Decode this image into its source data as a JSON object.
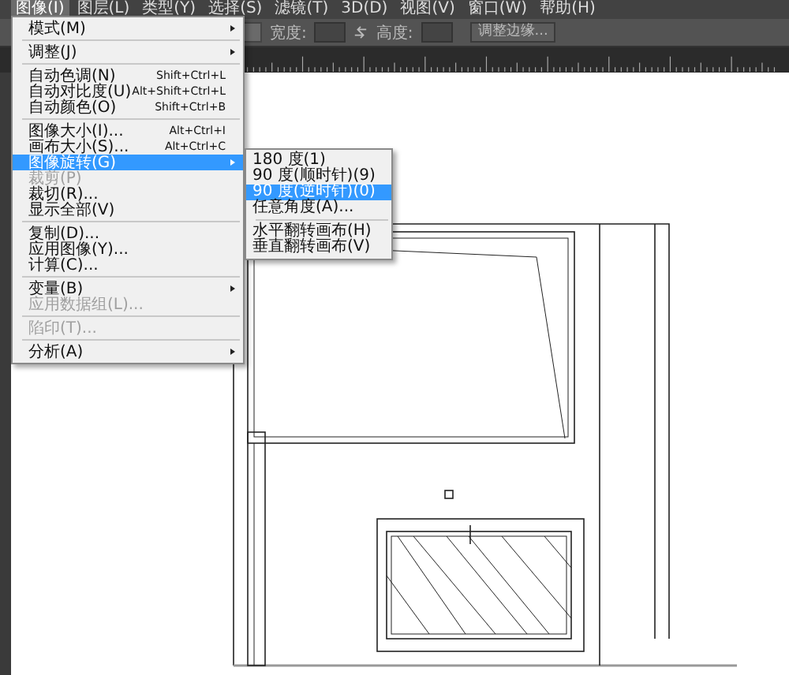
{
  "menubar": {
    "items": [
      {
        "label": "图像(I)",
        "selected": true
      },
      {
        "label": "图层(L)",
        "selected": false
      },
      {
        "label": "类型(Y)",
        "selected": false
      },
      {
        "label": "选择(S)",
        "selected": false
      },
      {
        "label": "滤镜(T)",
        "selected": false
      },
      {
        "label": "3D(D)",
        "selected": false
      },
      {
        "label": "视图(V)",
        "selected": false
      },
      {
        "label": "窗口(W)",
        "selected": false
      },
      {
        "label": "帮助(H)",
        "selected": false
      }
    ]
  },
  "options_bar": {
    "width_label": "宽度:",
    "height_label": "高度:",
    "button": "调整边缘..."
  },
  "menu": {
    "items": [
      {
        "kind": "item",
        "label": "模式(M)",
        "submenu": true,
        "disabled": false,
        "selected": false
      },
      {
        "kind": "separator"
      },
      {
        "kind": "item",
        "label": "调整(J)",
        "submenu": true,
        "disabled": false,
        "selected": false
      },
      {
        "kind": "separator"
      },
      {
        "kind": "item",
        "label": "自动色调(N)",
        "shortcut": "Shift+Ctrl+L",
        "submenu": false,
        "disabled": false,
        "selected": false
      },
      {
        "kind": "item",
        "label": "自动对比度(U)",
        "shortcut": "Alt+Shift+Ctrl+L",
        "submenu": false,
        "disabled": false,
        "selected": false
      },
      {
        "kind": "item",
        "label": "自动颜色(O)",
        "shortcut": "Shift+Ctrl+B",
        "submenu": false,
        "disabled": false,
        "selected": false
      },
      {
        "kind": "separator"
      },
      {
        "kind": "item",
        "label": "图像大小(I)...",
        "shortcut": "Alt+Ctrl+I",
        "submenu": false,
        "disabled": false,
        "selected": false
      },
      {
        "kind": "item",
        "label": "画布大小(S)...",
        "shortcut": "Alt+Ctrl+C",
        "submenu": false,
        "disabled": false,
        "selected": false
      },
      {
        "kind": "item",
        "label": "图像旋转(G)",
        "submenu": true,
        "disabled": false,
        "selected": true
      },
      {
        "kind": "item",
        "label": "裁剪(P)",
        "submenu": false,
        "disabled": true,
        "selected": false
      },
      {
        "kind": "item",
        "label": "裁切(R)...",
        "submenu": false,
        "disabled": false,
        "selected": false
      },
      {
        "kind": "item",
        "label": "显示全部(V)",
        "submenu": false,
        "disabled": false,
        "selected": false
      },
      {
        "kind": "separator"
      },
      {
        "kind": "item",
        "label": "复制(D)...",
        "submenu": false,
        "disabled": false,
        "selected": false
      },
      {
        "kind": "item",
        "label": "应用图像(Y)...",
        "submenu": false,
        "disabled": false,
        "selected": false
      },
      {
        "kind": "item",
        "label": "计算(C)...",
        "submenu": false,
        "disabled": false,
        "selected": false
      },
      {
        "kind": "separator"
      },
      {
        "kind": "item",
        "label": "变量(B)",
        "submenu": true,
        "disabled": false,
        "selected": false
      },
      {
        "kind": "item",
        "label": "应用数据组(L)...",
        "submenu": false,
        "disabled": true,
        "selected": false
      },
      {
        "kind": "separator"
      },
      {
        "kind": "item",
        "label": "陷印(T)...",
        "submenu": false,
        "disabled": true,
        "selected": false
      },
      {
        "kind": "separator"
      },
      {
        "kind": "item",
        "label": "分析(A)",
        "submenu": true,
        "disabled": false,
        "selected": false
      }
    ]
  },
  "submenu": {
    "items": [
      {
        "kind": "item",
        "label": "180 度(1)",
        "selected": false
      },
      {
        "kind": "item",
        "label": "90 度(顺时针)(9)",
        "selected": false
      },
      {
        "kind": "item",
        "label": "90 度(逆时针)(0)",
        "selected": true
      },
      {
        "kind": "item",
        "label": "任意角度(A)...",
        "selected": false
      },
      {
        "kind": "separator"
      },
      {
        "kind": "item",
        "label": "水平翻转画布(H)",
        "selected": false
      },
      {
        "kind": "item",
        "label": "垂直翻转画布(V)",
        "selected": false
      }
    ]
  }
}
